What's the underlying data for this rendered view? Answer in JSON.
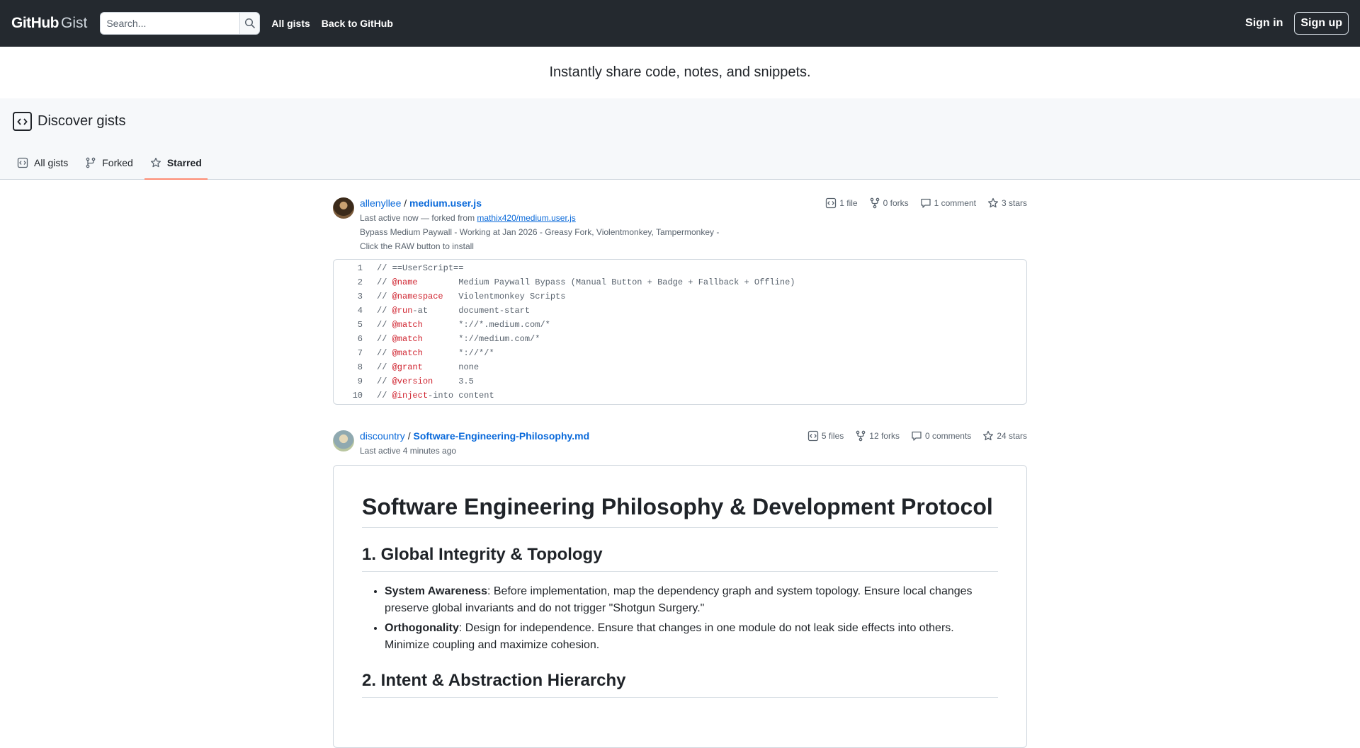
{
  "header": {
    "logo_main": "GitHub",
    "logo_sub": "Gist",
    "search_placeholder": "Search...",
    "nav": [
      "All gists",
      "Back to GitHub"
    ],
    "sign_in": "Sign in",
    "sign_up": "Sign up"
  },
  "tagline": "Instantly share code, notes, and snippets.",
  "discover": {
    "title": "Discover gists",
    "tabs": [
      {
        "label": "All gists",
        "icon": "code-square-icon",
        "active": false
      },
      {
        "label": "Forked",
        "icon": "fork-icon",
        "active": false
      },
      {
        "label": "Starred",
        "icon": "star-icon",
        "active": true
      }
    ]
  },
  "gists": [
    {
      "user": "allenyllee",
      "sep": " / ",
      "file": "medium.user.js",
      "active": "Last active now — forked from ",
      "forked_from": "mathix420/medium.user.js",
      "description_1": "Bypass Medium Paywall - Working at Jan 2026 - Greasy Fork, Violentmonkey, Tampermonkey -",
      "description_2": "Click the RAW button to install",
      "stats": {
        "files": "1 file",
        "forks": "0 forks",
        "comments": "1 comment",
        "stars": "3 stars"
      },
      "code": [
        {
          "n": "1",
          "pre": "// ==UserScript==",
          "kw": "",
          "rest": ""
        },
        {
          "n": "2",
          "pre": "// ",
          "kw": "@name",
          "rest": "        Medium Paywall Bypass (Manual Button + Badge + Fallback + Offline)"
        },
        {
          "n": "3",
          "pre": "// ",
          "kw": "@namespace",
          "rest": "   Violentmonkey Scripts"
        },
        {
          "n": "4",
          "pre": "// ",
          "kw": "@run",
          "rest": "-at      document-start"
        },
        {
          "n": "5",
          "pre": "// ",
          "kw": "@match",
          "rest": "       *://*.medium.com/*"
        },
        {
          "n": "6",
          "pre": "// ",
          "kw": "@match",
          "rest": "       *://medium.com/*"
        },
        {
          "n": "7",
          "pre": "// ",
          "kw": "@match",
          "rest": "       *://*/*"
        },
        {
          "n": "8",
          "pre": "// ",
          "kw": "@grant",
          "rest": "       none"
        },
        {
          "n": "9",
          "pre": "// ",
          "kw": "@version",
          "rest": "     3.5"
        },
        {
          "n": "10",
          "pre": "// ",
          "kw": "@inject",
          "rest": "-into content"
        }
      ]
    },
    {
      "user": "discountry",
      "sep": " / ",
      "file": "Software-Engineering-Philosophy.md",
      "active": "Last active 4 minutes ago",
      "stats": {
        "files": "5 files",
        "forks": "12 forks",
        "comments": "0 comments",
        "stars": "24 stars"
      },
      "markdown": {
        "h1": "Software Engineering Philosophy & Development Protocol",
        "h2_1": "1. Global Integrity & Topology",
        "items": [
          {
            "bold": "System Awareness",
            "text": ": Before implementation, map the dependency graph and system topology. Ensure local changes preserve global invariants and do not trigger \"Shotgun Surgery.\""
          },
          {
            "bold": "Orthogonality",
            "text": ": Design for independence. Ensure that changes in one module do not leak side effects into others. Minimize coupling and maximize cohesion."
          }
        ],
        "h2_2": "2. Intent & Abstraction Hierarchy"
      }
    }
  ]
}
